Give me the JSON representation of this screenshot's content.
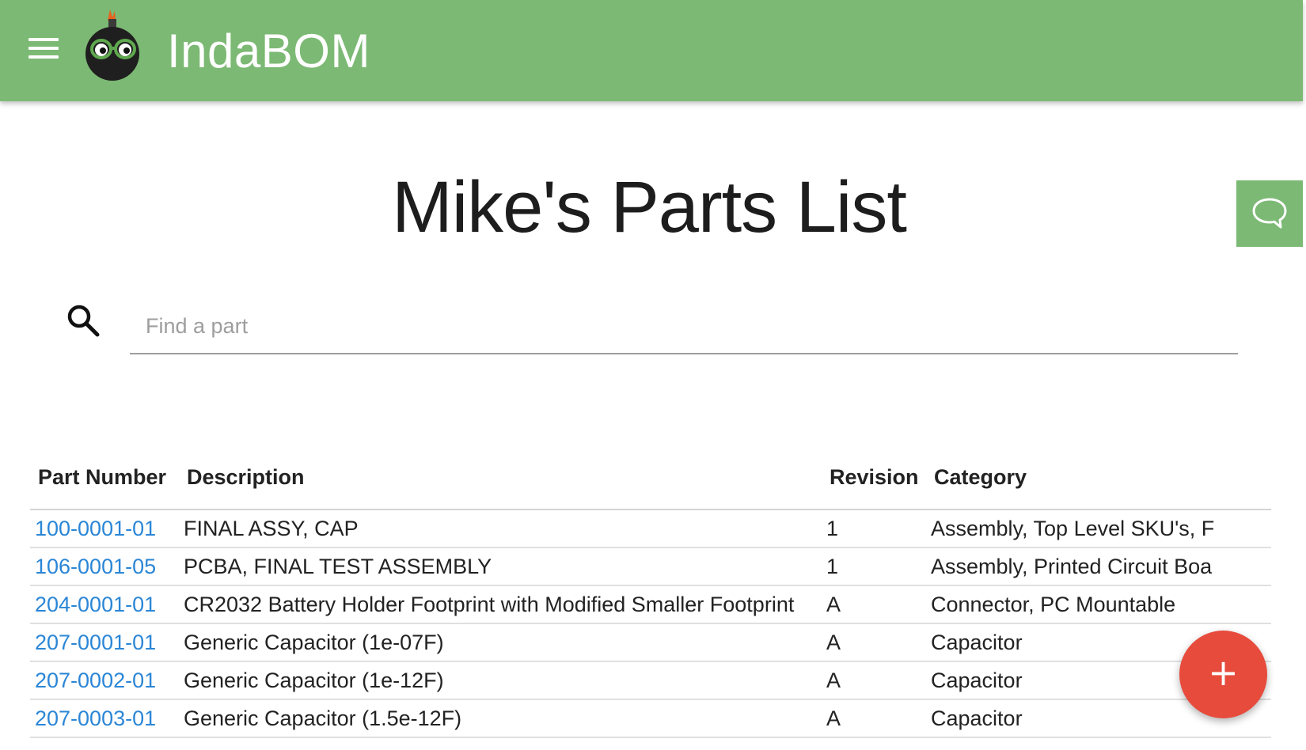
{
  "app": {
    "name": "IndaBOM"
  },
  "header": {
    "menu_icon": "hamburger-menu-icon",
    "logo_icon": "indabom-bomb-logo-icon"
  },
  "page": {
    "title": "Mike's Parts List"
  },
  "search": {
    "placeholder": "Find a part",
    "value": ""
  },
  "table": {
    "columns": [
      "Part Number",
      "Description",
      "Revision",
      "Category"
    ],
    "rows": [
      {
        "part_number": "100-0001-01",
        "description": "FINAL ASSY, CAP",
        "revision": "1",
        "category": "Assembly, Top Level SKU's, F"
      },
      {
        "part_number": "106-0001-05",
        "description": "PCBA, FINAL TEST ASSEMBLY",
        "revision": "1",
        "category": "Assembly, Printed Circuit Boa"
      },
      {
        "part_number": "204-0001-01",
        "description": "CR2032 Battery Holder Footprint with Modified Smaller Footprint",
        "revision": "A",
        "category": "Connector, PC Mountable"
      },
      {
        "part_number": "207-0001-01",
        "description": "Generic Capacitor (1e-07F)",
        "revision": "A",
        "category": "Capacitor"
      },
      {
        "part_number": "207-0002-01",
        "description": "Generic Capacitor (1e-12F)",
        "revision": "A",
        "category": "Capacitor"
      },
      {
        "part_number": "207-0003-01",
        "description": "Generic Capacitor (1.5e-12F)",
        "revision": "A",
        "category": "Capacitor"
      }
    ]
  },
  "fab": {
    "label": "+"
  },
  "colors": {
    "header_bg": "#7cb974",
    "link": "#2b86d6",
    "fab_bg": "#e74b3c"
  }
}
